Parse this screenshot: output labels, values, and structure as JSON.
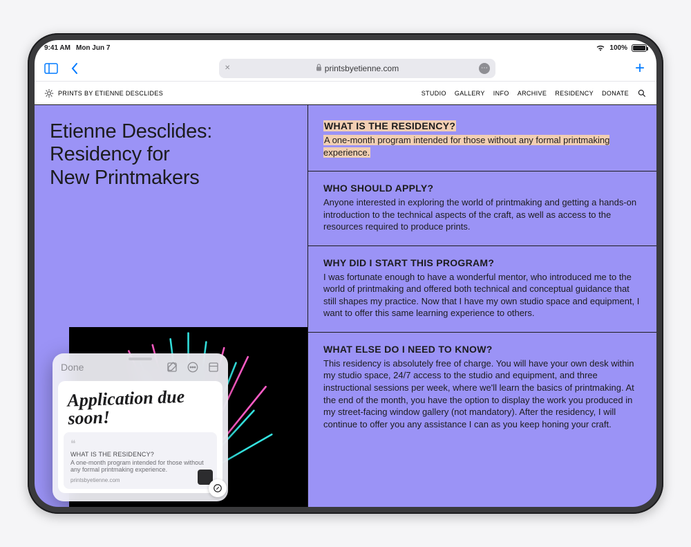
{
  "status": {
    "time": "9:41 AM",
    "date": "Mon Jun 7",
    "battery": "100%"
  },
  "safari": {
    "url": "printsbyetienne.com"
  },
  "site": {
    "title": "PRINTS BY ETIENNE DESCLIDES",
    "nav": {
      "studio": "STUDIO",
      "gallery": "GALLERY",
      "info": "INFO",
      "archive": "ARCHIVE",
      "residency": "RESIDENCY",
      "donate": "DONATE"
    }
  },
  "page": {
    "heading_l1": "Etienne Desclides:",
    "heading_l2": "Residency for",
    "heading_l3": "New Printmakers"
  },
  "faq": [
    {
      "q": "WHAT IS THE RESIDENCY?",
      "a": "A one-month program intended for those without any formal printmaking experience.",
      "highlighted": true
    },
    {
      "q": "WHO SHOULD APPLY?",
      "a": "Anyone interested in exploring the world of printmaking and getting a hands-on introduction to the technical aspects of the craft, as well as access to the resources required to produce prints."
    },
    {
      "q": "WHY DID I START THIS PROGRAM?",
      "a": "I was fortunate enough to have a wonderful mentor, who introduced me to the world of printmaking and offered both technical and conceptual guidance that still shapes my practice. Now that I have my own studio space and equipment, I want to offer this same learning experience to others."
    },
    {
      "q": "WHAT ELSE DO I NEED TO KNOW?",
      "a": "This residency is absolutely free of charge. You will have your own desk within my studio space, 24/7 access to the studio and equipment, and three instructional sessions per week, where we'll learn the basics of printmaking. At the end of the month, you have the option to display the work you produced in my street-facing window gallery (not mandatory). After the residency, I will continue to offer you any assistance I can as you keep honing your craft."
    }
  ],
  "quicknote": {
    "done": "Done",
    "handwriting": "Application due soon!",
    "link": {
      "title": "WHAT IS THE RESIDENCY?",
      "desc": "A one-month program intended for those without any formal printmaking experience.",
      "source": "printsbyetienne.com"
    }
  }
}
